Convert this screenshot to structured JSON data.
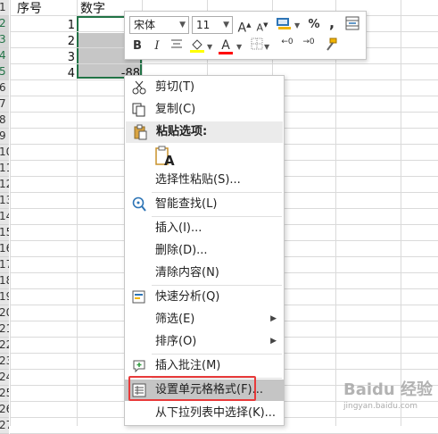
{
  "sheet": {
    "row_headers": [
      "1",
      "2",
      "3",
      "4",
      "5",
      "6",
      "7",
      "8",
      "9",
      "10",
      "11",
      "12",
      "13",
      "14",
      "15",
      "16",
      "17",
      "18",
      "19",
      "20",
      "21",
      "22",
      "23",
      "24",
      "25",
      "26",
      "27"
    ],
    "header_a": "序号",
    "header_b": "数字",
    "col_a_values": [
      "1",
      "2",
      "3",
      "4"
    ],
    "col_b_values": [
      "",
      "-",
      "-",
      "-88"
    ]
  },
  "mini_toolbar": {
    "font_name": "宋体",
    "font_size": "11",
    "grow_font": "A",
    "shrink_font": "A",
    "percent": "%",
    "comma": ",",
    "bold": "B",
    "italic": "I",
    "font_color_letter": "A",
    "dec_inc": "←0",
    "dec_dec": "→0",
    "colors": {
      "highlight": "#ffff00",
      "font": "#ff0000"
    }
  },
  "context_menu": {
    "items": [
      {
        "label": "剪切(T)",
        "icon": "scissors-icon"
      },
      {
        "label": "复制(C)",
        "icon": "copy-icon"
      },
      {
        "label": "粘贴选项:",
        "icon": "clipboard-icon"
      },
      {
        "label": "选择性粘贴(S)...",
        "icon": ""
      },
      {
        "label": "智能查找(L)",
        "icon": "smart-lookup-icon"
      },
      {
        "label": "插入(I)...",
        "icon": ""
      },
      {
        "label": "删除(D)...",
        "icon": ""
      },
      {
        "label": "清除内容(N)",
        "icon": ""
      },
      {
        "label": "快速分析(Q)",
        "icon": "quick-analysis-icon"
      },
      {
        "label": "筛选(E)",
        "icon": ""
      },
      {
        "label": "排序(O)",
        "icon": ""
      },
      {
        "label": "插入批注(M)",
        "icon": "comment-icon"
      },
      {
        "label": "设置单元格格式(F)...",
        "icon": "format-cells-icon"
      },
      {
        "label": "从下拉列表中选择(K)...",
        "icon": ""
      }
    ],
    "paste_letter": "A"
  },
  "watermark": {
    "text": "Baidu 经验",
    "sub": "jingyan.baidu.com"
  },
  "accent": "#217346",
  "highlight_color": "#e83a3a"
}
